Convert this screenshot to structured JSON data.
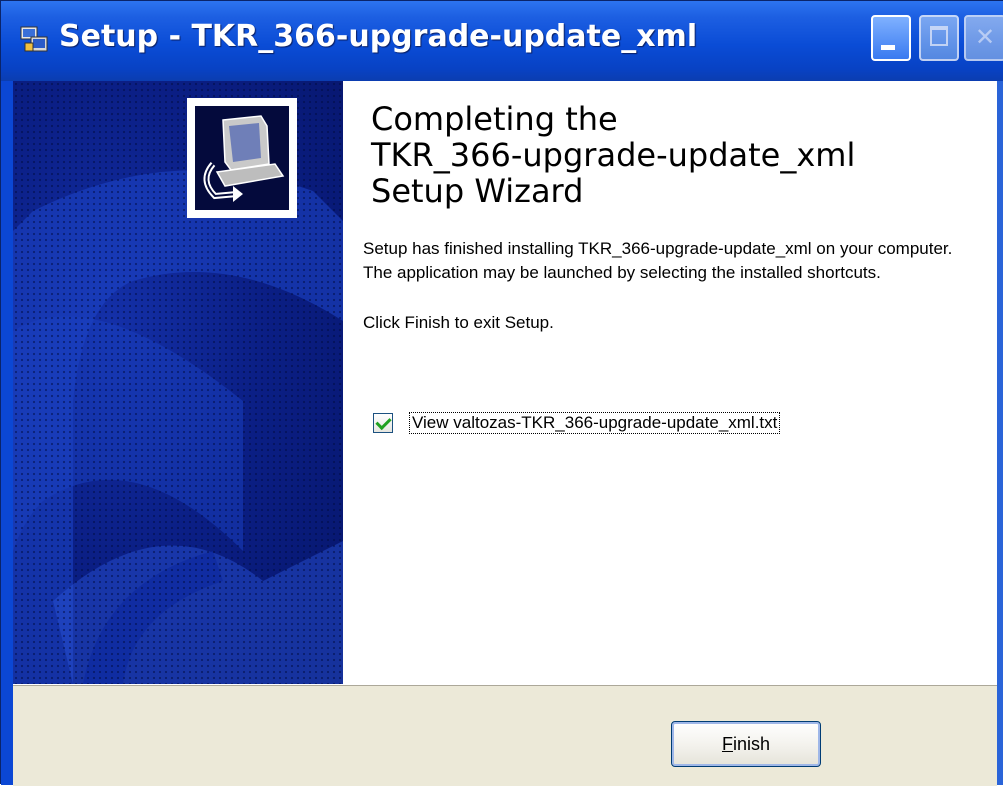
{
  "window": {
    "title": "Setup - TKR_366-upgrade-update_xml",
    "icon": "setup-app-icon"
  },
  "heading": {
    "line1": "Completing the",
    "line2": "TKR_366-upgrade-update_xml",
    "line3": "Setup Wizard"
  },
  "body": {
    "finished_text": "Setup has finished installing TKR_366-upgrade-update_xml on your computer. The application may be launched by selecting the installed shortcuts.",
    "exit_text": "Click Finish to exit Setup."
  },
  "checkbox": {
    "label": "View valtozas-TKR_366-upgrade-update_xml.txt",
    "checked": true
  },
  "buttons": {
    "finish_first": "F",
    "finish_rest": "inish"
  },
  "colors": {
    "titlebar": "#0a4cd6",
    "side_panel": "#0b1f86",
    "button_face": "#ece9d8"
  }
}
